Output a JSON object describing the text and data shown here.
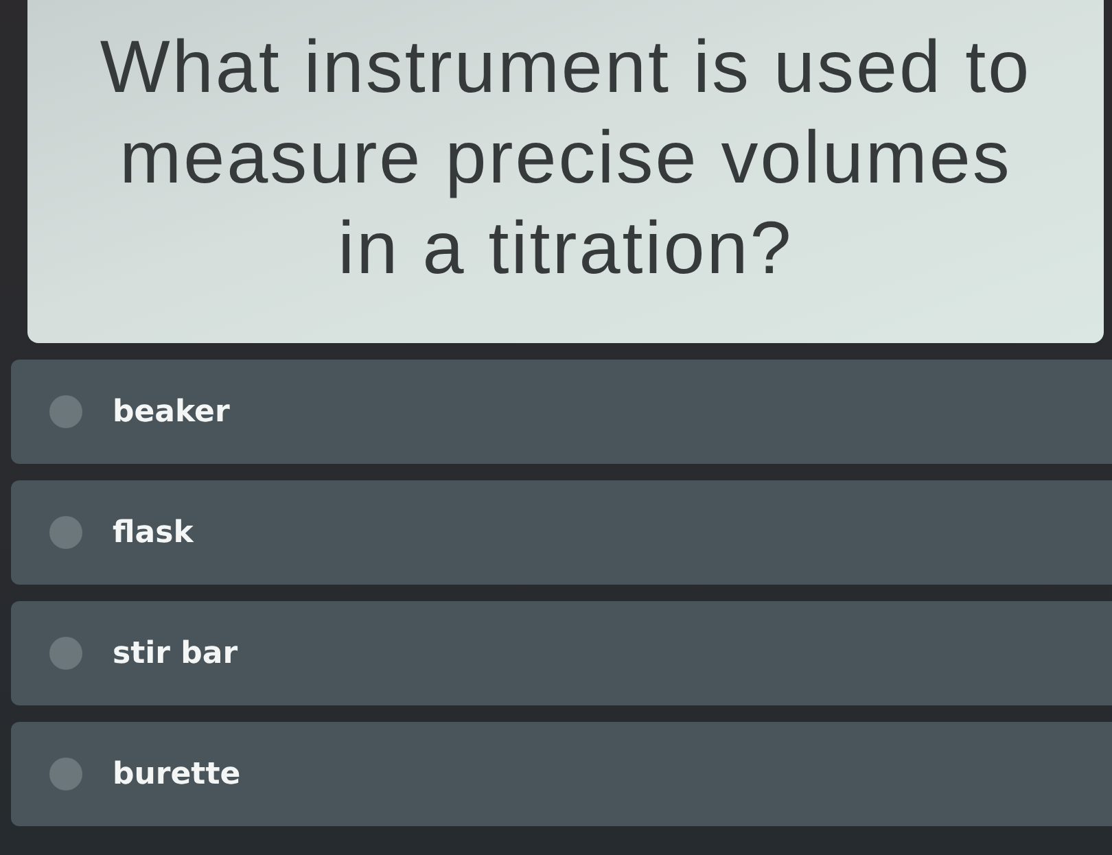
{
  "question": {
    "text": "What instrument is used to measure precise volumes in a titration?"
  },
  "options": [
    {
      "label": "beaker",
      "selected": false
    },
    {
      "label": "flask",
      "selected": false
    },
    {
      "label": "stir bar",
      "selected": false
    },
    {
      "label": "burette",
      "selected": false
    }
  ]
}
